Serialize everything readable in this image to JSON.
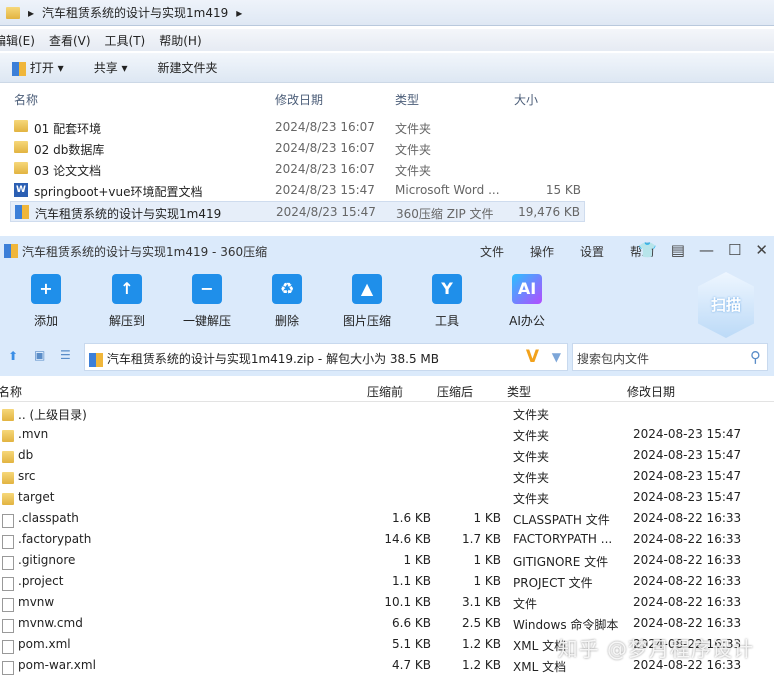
{
  "explorer": {
    "breadcrumb": "汽车租赁系统的设计与实现1m419",
    "menu": [
      "编辑(E)",
      "查看(V)",
      "工具(T)",
      "帮助(H)"
    ],
    "toolbar": {
      "open": "打开",
      "share": "共享",
      "new_folder": "新建文件夹"
    },
    "columns": [
      "名称",
      "修改日期",
      "类型",
      "大小"
    ],
    "rows": [
      {
        "name": "01 配套环境",
        "date": "2024/8/23 16:07",
        "type": "文件夹",
        "size": "",
        "icon": "folder-icon"
      },
      {
        "name": "02 db数据库",
        "date": "2024/8/23 16:07",
        "type": "文件夹",
        "size": "",
        "icon": "folder-icon"
      },
      {
        "name": "03 论文文档",
        "date": "2024/8/23 16:07",
        "type": "文件夹",
        "size": "",
        "icon": "folder-icon"
      },
      {
        "name": "springboot+vue环境配置文档",
        "date": "2024/8/23 15:47",
        "type": "Microsoft Word ...",
        "size": "15 KB",
        "icon": "word-icon"
      },
      {
        "name": "汽车租赁系统的设计与实现1m419",
        "date": "2024/8/23 15:47",
        "type": "360压缩 ZIP 文件",
        "size": "19,476 KB",
        "icon": "zip-icon"
      }
    ]
  },
  "zip": {
    "title": "汽车租赁系统的设计与实现1m419 - 360压缩",
    "menu": [
      "文件",
      "操作",
      "设置",
      "帮助"
    ],
    "tools": [
      {
        "label": "添加",
        "glyph": "+"
      },
      {
        "label": "解压到",
        "glyph": "↑"
      },
      {
        "label": "一键解压",
        "glyph": "−"
      },
      {
        "label": "删除",
        "glyph": "♻"
      },
      {
        "label": "图片压缩",
        "glyph": "▲"
      },
      {
        "label": "工具",
        "glyph": "Y"
      },
      {
        "label": "AI办公",
        "glyph": "AI"
      }
    ],
    "scan": "扫描",
    "address": "汽车租赁系统的设计与实现1m419.zip - 解包大小为 38.5 MB",
    "search_placeholder": "搜索包内文件",
    "columns": [
      "名称",
      "压缩前",
      "压缩后",
      "类型",
      "修改日期"
    ],
    "rows": [
      {
        "name": ".. (上级目录)",
        "before": "",
        "after": "",
        "type": "文件夹",
        "date": "",
        "icon": "folder"
      },
      {
        "name": ".mvn",
        "before": "",
        "after": "",
        "type": "文件夹",
        "date": "2024-08-23 15:47",
        "icon": "folder"
      },
      {
        "name": "db",
        "before": "",
        "after": "",
        "type": "文件夹",
        "date": "2024-08-23 15:47",
        "icon": "folder"
      },
      {
        "name": "src",
        "before": "",
        "after": "",
        "type": "文件夹",
        "date": "2024-08-23 15:47",
        "icon": "folder"
      },
      {
        "name": "target",
        "before": "",
        "after": "",
        "type": "文件夹",
        "date": "2024-08-23 15:47",
        "icon": "folder"
      },
      {
        "name": ".classpath",
        "before": "1.6 KB",
        "after": "1 KB",
        "type": "CLASSPATH 文件",
        "date": "2024-08-22 16:33",
        "icon": "file"
      },
      {
        "name": ".factorypath",
        "before": "14.6 KB",
        "after": "1.7 KB",
        "type": "FACTORYPATH ...",
        "date": "2024-08-22 16:33",
        "icon": "file"
      },
      {
        "name": ".gitignore",
        "before": "1 KB",
        "after": "1 KB",
        "type": "GITIGNORE 文件",
        "date": "2024-08-22 16:33",
        "icon": "file"
      },
      {
        "name": ".project",
        "before": "1.1 KB",
        "after": "1 KB",
        "type": "PROJECT 文件",
        "date": "2024-08-22 16:33",
        "icon": "file"
      },
      {
        "name": "mvnw",
        "before": "10.1 KB",
        "after": "3.1 KB",
        "type": "文件",
        "date": "2024-08-22 16:33",
        "icon": "file"
      },
      {
        "name": "mvnw.cmd",
        "before": "6.6 KB",
        "after": "2.5 KB",
        "type": "Windows 命令脚本",
        "date": "2024-08-22 16:33",
        "icon": "file"
      },
      {
        "name": "pom.xml",
        "before": "5.1 KB",
        "after": "1.2 KB",
        "type": "XML 文档",
        "date": "2024-08-22 16:33",
        "icon": "file"
      },
      {
        "name": "pom-war.xml",
        "before": "4.7 KB",
        "after": "1.2 KB",
        "type": "XML 文档",
        "date": "2024-08-22 16:33",
        "icon": "file"
      }
    ]
  },
  "watermark": "知乎 @梦月程序设计"
}
